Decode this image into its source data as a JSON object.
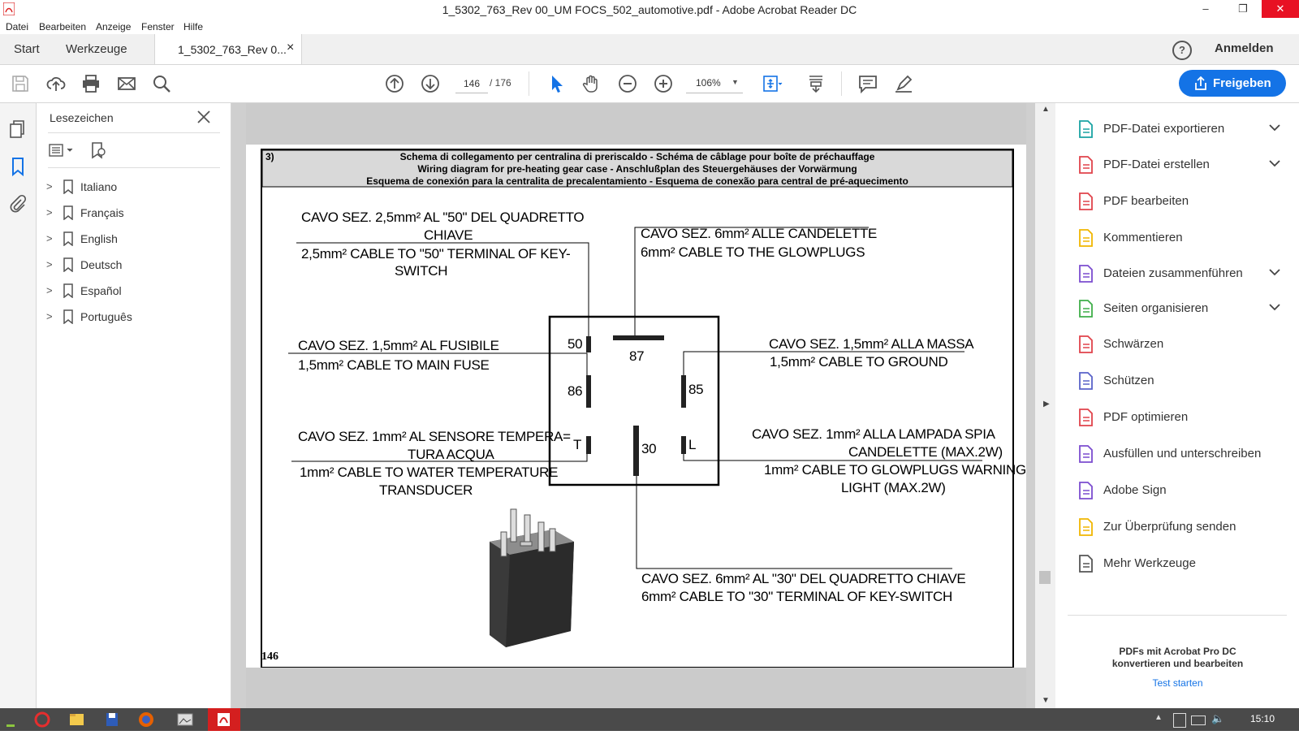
{
  "window": {
    "title": "1_5302_763_Rev 00_UM FOCS_502_automotive.pdf - Adobe Acrobat Reader DC",
    "minimize": "–",
    "restore": "❐",
    "close": "✕"
  },
  "menu": [
    "Datei",
    "Bearbeiten",
    "Anzeige",
    "Fenster",
    "Hilfe"
  ],
  "tabs": {
    "start": "Start",
    "tools": "Werkzeuge",
    "document": "1_5302_763_Rev 0...",
    "close_glyph": "×",
    "help_glyph": "?",
    "signin": "Anmelden"
  },
  "toolbar": {
    "icons": [
      "save-icon",
      "upload-icon",
      "print-icon",
      "email-icon",
      "search-icon",
      "page-up-icon",
      "page-down-icon",
      "select-icon",
      "hand-icon",
      "zoom-out-icon",
      "zoom-in-icon",
      "fit-icon",
      "scroll-mode-icon",
      "comment-icon",
      "highlight-icon"
    ],
    "page_current": "146",
    "page_total": "/ 176",
    "zoom": "106%",
    "share_label": "Freigeben"
  },
  "bookmarks": {
    "title": "Lesezeichen",
    "items": [
      {
        "label": "Italiano"
      },
      {
        "label": "Français"
      },
      {
        "label": "English"
      },
      {
        "label": "Deutsch"
      },
      {
        "label": "Español"
      },
      {
        "label": "Português"
      }
    ]
  },
  "document": {
    "section_number": "3)",
    "header_lines": [
      "Schema di collegamento per centralina di preriscaldo - Schéma de câblage pour boîte de préchauffage",
      "Wiring diagram for pre-heating gear case - Anschlußplan des Steuergehäuses der Vorwärmung",
      "Esquema de conexión para la centralita de precalentamiento - Esquema de conexão para central de pré-aquecimento"
    ],
    "page_number": "146",
    "labels": {
      "cable50_it_1": "CAVO SEZ. 2,5mm² AL \"50\"  DEL QUADRETTO",
      "cable50_it_2": "CHIAVE",
      "cable50_en_1": "2,5mm² CABLE TO \"50\" TERMINAL OF KEY-",
      "cable50_en_2": "SWITCH",
      "glow_it": "CAVO SEZ. 6mm² ALLE  CANDELETTE",
      "glow_en": "6mm² CABLE TO THE GLOWPLUGS",
      "fuse_it": "CAVO SEZ. 1,5mm² AL FUSIBILE",
      "fuse_en": "1,5mm² CABLE TO MAIN FUSE",
      "ground_it": "CAVO SEZ. 1,5mm² ALLA MASSA",
      "ground_en": "1,5mm² CABLE TO GROUND",
      "temp_it_1": "CAVO SEZ. 1mm² AL SENSORE TEMPERA=",
      "temp_it_2": "TURA ACQUA",
      "temp_en_1": "1mm² CABLE TO WATER TEMPERATURE",
      "temp_en_2": "TRANSDUCER",
      "lamp_it_1": "CAVO SEZ. 1mm² ALLA LAMPADA SPIA",
      "lamp_it_2": "CANDELETTE (MAX.2W)",
      "lamp_en_1": "1mm² CABLE TO GLOWPLUGS WARNING",
      "lamp_en_2": "LIGHT (MAX.2W)",
      "key30_it": "CAVO SEZ. 6mm² AL \"30\" DEL QUADRETTO CHIAVE",
      "key30_en": "6mm² CABLE TO \"30\" TERMINAL OF KEY-SWITCH",
      "pin_50": "50",
      "pin_87": "87",
      "pin_86": "86",
      "pin_85": "85",
      "pin_T": "T",
      "pin_30": "30",
      "pin_L": "L"
    }
  },
  "tools": [
    {
      "label": "PDF-Datei exportieren",
      "icon": "export-pdf-icon",
      "color": "#1aa3a3",
      "chevron": true
    },
    {
      "label": "PDF-Datei erstellen",
      "icon": "create-pdf-icon",
      "color": "#e0434b",
      "chevron": true
    },
    {
      "label": "PDF bearbeiten",
      "icon": "edit-pdf-icon",
      "color": "#e0434b",
      "chevron": false
    },
    {
      "label": "Kommentieren",
      "icon": "comment-tool-icon",
      "color": "#f1b600",
      "chevron": false
    },
    {
      "label": "Dateien zusammenführen",
      "icon": "combine-files-icon",
      "color": "#7c4dcf",
      "chevron": true
    },
    {
      "label": "Seiten organisieren",
      "icon": "organize-pages-icon",
      "color": "#3fae49",
      "chevron": true
    },
    {
      "label": "Schwärzen",
      "icon": "redact-icon",
      "color": "#e0434b",
      "chevron": false
    },
    {
      "label": "Schützen",
      "icon": "protect-icon",
      "color": "#5a63c9",
      "chevron": false
    },
    {
      "label": "PDF optimieren",
      "icon": "optimize-pdf-icon",
      "color": "#e0434b",
      "chevron": false
    },
    {
      "label": "Ausfüllen und unterschreiben",
      "icon": "fill-sign-icon",
      "color": "#7c4dcf",
      "chevron": false
    },
    {
      "label": "Adobe Sign",
      "icon": "adobe-sign-icon",
      "color": "#7c4dcf",
      "chevron": false
    },
    {
      "label": "Zur Überprüfung senden",
      "icon": "send-review-icon",
      "color": "#f1b600",
      "chevron": false
    },
    {
      "label": "Mehr Werkzeuge",
      "icon": "more-tools-icon",
      "color": "#555555",
      "chevron": false
    }
  ],
  "promo": {
    "line1": "PDFs mit Acrobat Pro DC",
    "line2": "konvertieren und bearbeiten",
    "link": "Test starten"
  },
  "taskbar": {
    "clock": "15:10",
    "apps": [
      "opera-icon",
      "file-explorer-icon",
      "save-app-icon",
      "firefox-icon",
      "image-app-icon",
      "acrobat-task-icon"
    ]
  }
}
